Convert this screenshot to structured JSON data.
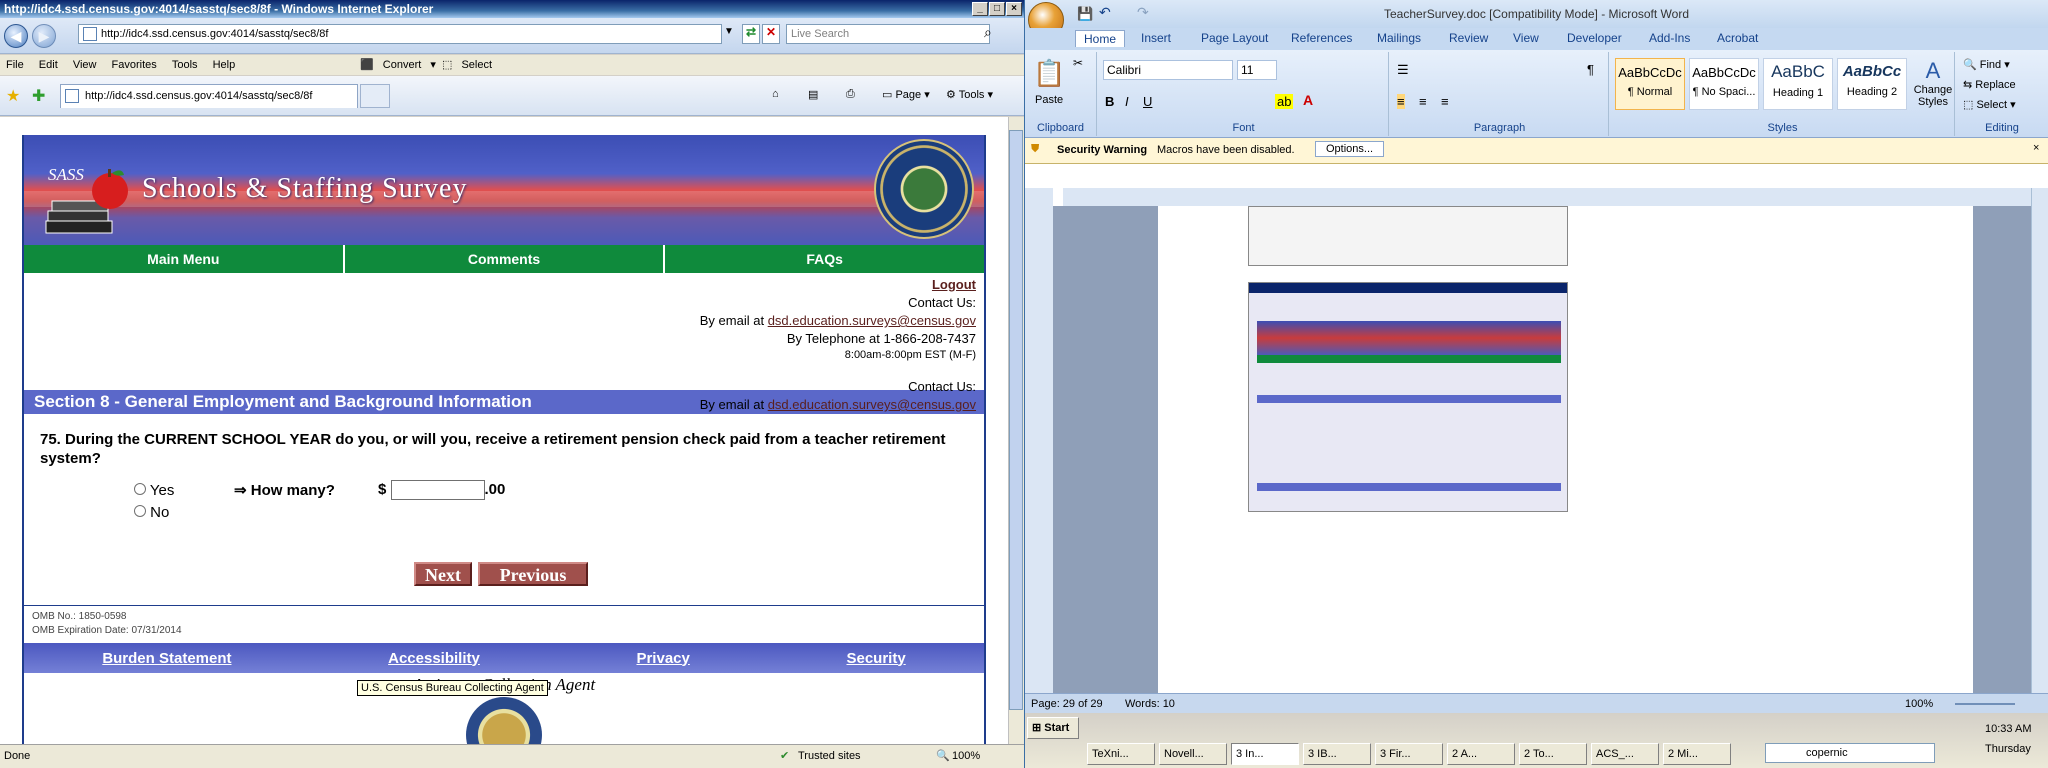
{
  "ie": {
    "title": "http://idc4.ssd.census.gov:4014/sasstq/sec8/8f - Windows Internet Explorer",
    "address": "http://idc4.ssd.census.gov:4014/sasstq/sec8/8f",
    "search_placeholder": "Live Search",
    "menus": [
      "File",
      "Edit",
      "View",
      "Favorites",
      "Tools",
      "Help"
    ],
    "convert_label": "Convert",
    "select_label": "Select",
    "tab_title": "http://idc4.ssd.census.gov:4014/sasstq/sec8/8f",
    "page_menu": "Page",
    "tools_menu": "Tools",
    "status_left": "Done",
    "status_zone": "Trusted sites",
    "zoom": "100%"
  },
  "survey": {
    "logo_text": "SASS",
    "banner_title": "Schools & Staffing Survey",
    "nav": [
      "Main Menu",
      "Comments",
      "FAQs"
    ],
    "logout": "Logout",
    "contact_label": "Contact Us:",
    "email_prefix": "By email at",
    "email": "dsd.education.surveys@census.gov",
    "telephone": "By Telephone at 1-866-208-7437",
    "hours": "8:00am-8:00pm EST (M-F)",
    "section": "Section 8 - General Employment and Background Information",
    "overlay_contact_label": "Contact Us:",
    "overlay_email_prefix": "By email at",
    "overlay_email": "dsd.education.surveys@census.gov",
    "question": "75. During the CURRENT SCHOOL YEAR do you, or will you, receive a retirement pension check paid from a teacher retirement system?",
    "yes": "Yes",
    "no": "No",
    "how_many": "⇒ How many?",
    "dollar": "$",
    "cents": ".00",
    "next": "Next",
    "previous": "Previous",
    "omb_no": "OMB No.: 1850-0598",
    "omb_exp": "OMB Expiration Date: 07/31/2014",
    "footer_links": [
      "Burden Statement",
      "Accessibility",
      "Privacy",
      "Security"
    ],
    "agent": "Acting as Collection Agent",
    "tooltip": "U.S. Census Bureau Collecting Agent"
  },
  "word": {
    "title": "TeacherSurvey.doc [Compatibility Mode] - Microsoft Word",
    "tabs": [
      "Home",
      "Insert",
      "Page Layout",
      "References",
      "Mailings",
      "Review",
      "View",
      "Developer",
      "Add-Ins",
      "Acrobat"
    ],
    "font": "Calibri",
    "size": "11",
    "paste": "Paste",
    "groups": [
      "Clipboard",
      "Font",
      "Paragraph",
      "Styles",
      "Editing"
    ],
    "styles": [
      {
        "preview": "AaBbCcDc",
        "name": "¶ Normal"
      },
      {
        "preview": "AaBbCcDc",
        "name": "¶ No Spaci..."
      },
      {
        "preview": "AaBbC",
        "name": "Heading 1"
      },
      {
        "preview": "AaBbCc",
        "name": "Heading 2"
      }
    ],
    "change_styles": "Change Styles",
    "find": "Find",
    "replace": "Replace",
    "select": "Select",
    "security_title": "Security Warning",
    "security_msg": "Macros have been disabled.",
    "options": "Options...",
    "status_page": "Page: 29 of 29",
    "status_words": "Words: 10",
    "zoom": "100%"
  },
  "taskbar": {
    "start": "Start",
    "buttons": [
      "TeXni...",
      "Novell...",
      "3 In...",
      "3 IB...",
      "3 Fir...",
      "2 A...",
      "2 To...",
      "ACS_...",
      "2 Mi..."
    ],
    "search_text": "copernic",
    "time": "10:33 AM",
    "day": "Thursday"
  }
}
